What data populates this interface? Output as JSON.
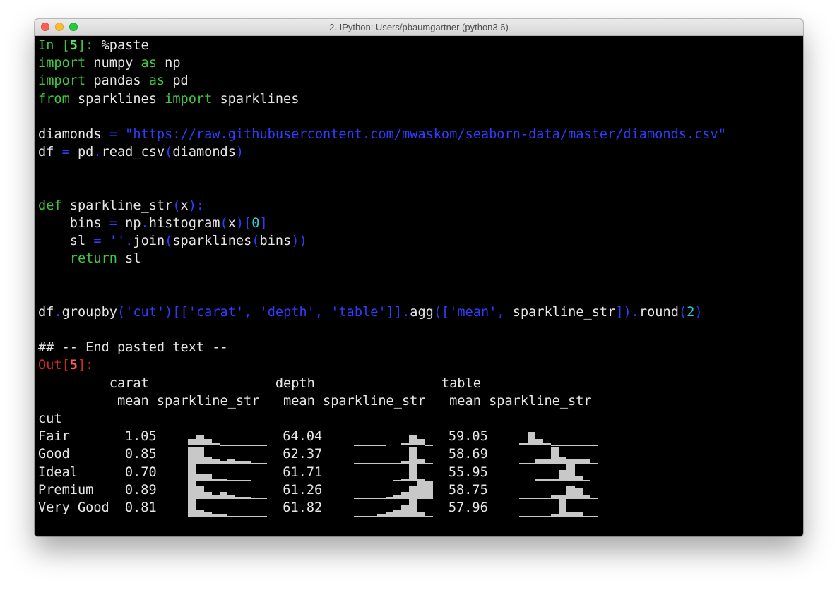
{
  "window": {
    "title": "2. IPython: Users/pbaumgartner (python3.6)"
  },
  "input_prompt": {
    "in": "In [",
    "num": "5",
    "close": "]: ",
    "command": "%paste"
  },
  "code": {
    "l1a": "import",
    "l1b": " numpy ",
    "l1c": "as",
    "l1d": " np",
    "l2a": "import",
    "l2b": " pandas ",
    "l2c": "as",
    "l2d": " pd",
    "l3a": "from",
    "l3b": " sparklines ",
    "l3c": "import",
    "l3d": " sparklines",
    "l5a": "diamonds ",
    "l5b": "=",
    "l5c": " ",
    "l5d": "\"https://raw.githubusercontent.com/mwaskom/seaborn-data/master/diamonds.csv\"",
    "l6a": "df ",
    "l6b": "=",
    "l6c": " pd",
    "l6d": ".",
    "l6e": "read_csv",
    "l6f": "(",
    "l6g": "diamonds",
    "l6h": ")",
    "l9a": "def",
    "l9b": " sparkline_str",
    "l9c": "(",
    "l9d": "x",
    "l9e": "):",
    "l10a": "    bins ",
    "l10b": "=",
    "l10c": " np",
    "l10d": ".",
    "l10e": "histogram",
    "l10f": "(",
    "l10g": "x",
    "l10h": ")[",
    "l10i": "0",
    "l10j": "]",
    "l11a": "    sl ",
    "l11b": "=",
    "l11c": " ",
    "l11d": "''",
    "l11e": ".",
    "l11f": "join",
    "l11g": "(",
    "l11h": "sparklines",
    "l11i": "(",
    "l11j": "bins",
    "l11k": "))",
    "l12a": "    ",
    "l12b": "return",
    "l12c": " sl",
    "l15a": "df",
    "l15b": ".",
    "l15c": "groupby",
    "l15d": "(",
    "l15e": "'cut'",
    "l15f": ")[[",
    "l15g": "'carat'",
    "l15h": ", ",
    "l15i": "'depth'",
    "l15j": ", ",
    "l15k": "'table'",
    "l15l": "]].",
    "l15m": "agg",
    "l15n": "([",
    "l15o": "'mean'",
    "l15p": ", ",
    "l15q": "sparkline_str",
    "l15r": "]).",
    "l15s": "round",
    "l15t": "(",
    "l15u": "2",
    "l15v": ")",
    "l17": "## -- End pasted text --"
  },
  "output_prompt": {
    "out": "Out[",
    "num": "5",
    "close": "]:"
  },
  "table": {
    "header1": "         carat                depth                table",
    "header2": "          mean sparkline_str   mean sparkline_str   mean sparkline_str",
    "index_name": "cut",
    "rows": [
      {
        "cut": "Fair",
        "carat_mean": "1.05",
        "depth_mean": "64.04",
        "table_mean": "59.05",
        "carat_spark": [
          3,
          5,
          3,
          1,
          0.25,
          0.25,
          0.25,
          0.25,
          0.25,
          0.25
        ],
        "depth_spark": [
          0.25,
          0.25,
          0.25,
          0.25,
          0.5,
          0.5,
          1,
          5,
          3,
          0.25
        ],
        "table_spark": [
          1,
          6,
          3,
          1,
          0.25,
          0.25,
          0.25,
          0.25,
          0.25,
          0.25
        ]
      },
      {
        "cut": "Good",
        "carat_mean": "0.85",
        "depth_mean": "62.37",
        "table_mean": "58.69",
        "carat_spark": [
          7,
          7,
          3,
          2,
          1,
          2,
          1,
          1,
          0.25,
          0.25
        ],
        "depth_spark": [
          0.25,
          0.25,
          0.25,
          0.25,
          0.25,
          0.25,
          1,
          7,
          2,
          0.25
        ],
        "table_spark": [
          0.25,
          0.25,
          2,
          2,
          7,
          3,
          2,
          2,
          2,
          0.25
        ]
      },
      {
        "cut": "Ideal",
        "carat_mean": "0.70",
        "depth_mean": "61.71",
        "table_mean": "55.95",
        "carat_spark": [
          8,
          3,
          3,
          1,
          1,
          0.5,
          0.5,
          0.5,
          0.25,
          0.25
        ],
        "depth_spark": [
          0.25,
          0.25,
          0.25,
          0.25,
          0.25,
          0.5,
          1,
          8,
          1,
          0.25
        ],
        "table_spark": [
          0.25,
          0.25,
          1,
          1,
          1,
          5,
          8,
          2,
          0.5,
          0.25
        ]
      },
      {
        "cut": "Premium",
        "carat_mean": "0.89",
        "depth_mean": "61.26",
        "table_mean": "58.75",
        "carat_spark": [
          8,
          6,
          3,
          2,
          3,
          2,
          1,
          1,
          0.25,
          0.25
        ],
        "depth_spark": [
          0.25,
          0.25,
          0.25,
          0.25,
          1,
          2,
          3,
          6,
          8,
          8
        ],
        "table_spark": [
          0.25,
          0.25,
          0.25,
          0.25,
          2,
          2,
          6,
          5,
          2,
          0.25
        ]
      },
      {
        "cut": "Very Good",
        "carat_mean": "0.81",
        "depth_mean": "61.82",
        "table_mean": "57.96",
        "carat_spark": [
          8,
          3,
          2,
          1,
          1,
          0.5,
          0.5,
          0.5,
          0.25,
          0.25
        ],
        "depth_spark": [
          0.25,
          0.25,
          0.5,
          1,
          2,
          3,
          5,
          8,
          2,
          0.25
        ],
        "table_spark": [
          0.25,
          0.25,
          0.25,
          0.25,
          1,
          8,
          2,
          2,
          0.5,
          0.25
        ]
      }
    ]
  },
  "colors": {
    "keyword": "#40c840",
    "operator": "#2f3cff",
    "number": "#2fd0d0",
    "out_prompt": "#d02a2a",
    "sparkline": "#c8c8c8"
  }
}
